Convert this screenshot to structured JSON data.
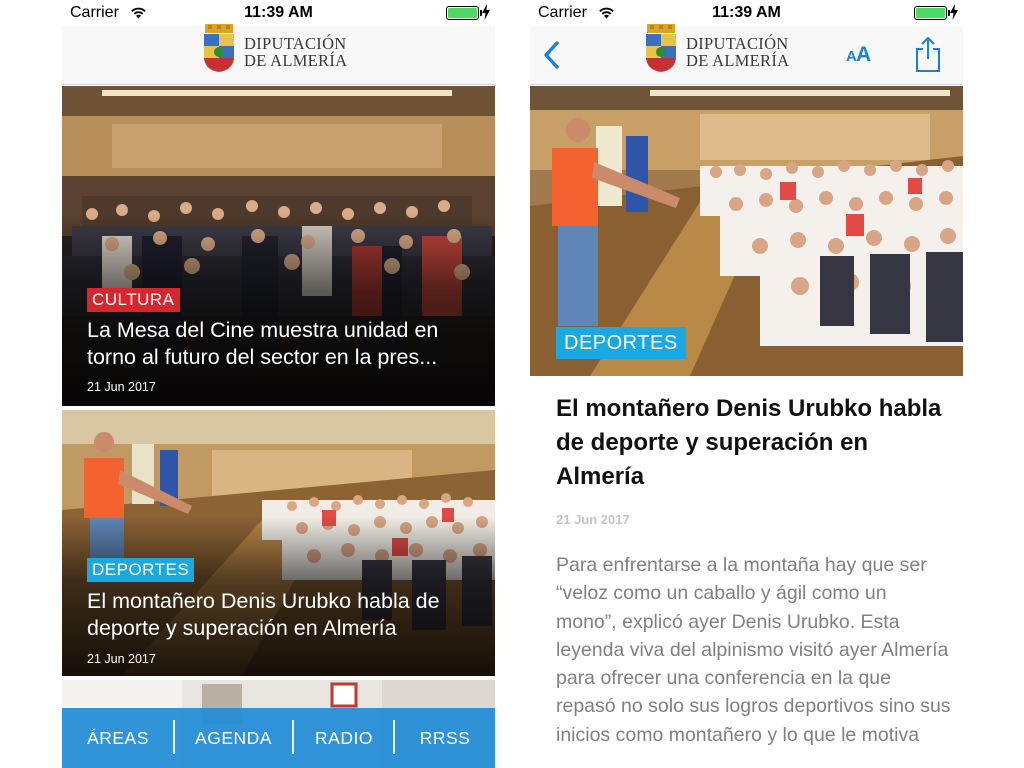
{
  "status_bar": {
    "carrier": "Carrier",
    "time": "11:39 AM",
    "battery_level": 1.0
  },
  "brand": {
    "line1": "DIPUTACIÓN",
    "line2": "DE ALMERÍA"
  },
  "feed": {
    "cards": [
      {
        "category": "CULTURA",
        "title": "La Mesa del Cine muestra unidad en torno al futuro del sector en la pres...",
        "date": "21 Jun 2017"
      },
      {
        "category": "DEPORTES",
        "title": "El montañero Denis Urubko habla de deporte y superación en Almería",
        "date": "21 Jun 2017"
      }
    ]
  },
  "tab_bar": {
    "items": [
      "ÁREAS",
      "AGENDA",
      "RADIO",
      "RRSS"
    ]
  },
  "article": {
    "category": "DEPORTES",
    "title": "El montañero Denis Urubko habla de deporte y superación en Almería",
    "date": "21 Jun 2017",
    "body": "Para enfrentarse a la montaña hay que ser “veloz como un caballo y ágil como un mono”, explicó ayer Denis Urubko. Esta leyenda viva del alpinismo visitó ayer Almería para ofrecer una conferencia en la que repasó no solo sus logros deportivos sino sus inicios como montañero y lo que le motiva"
  },
  "font_size_button": {
    "small": "A",
    "large": "A"
  },
  "colors": {
    "accent_blue": "#1a82d8",
    "cultura_badge": "#d8262e",
    "deportes_badge": "#1ba7e0",
    "tab_bar": "#248dd6"
  },
  "icons": [
    "wifi-icon",
    "battery-icon",
    "charging-bolt-icon",
    "crest-icon",
    "back-chevron-icon",
    "font-size-icon",
    "share-icon"
  ]
}
